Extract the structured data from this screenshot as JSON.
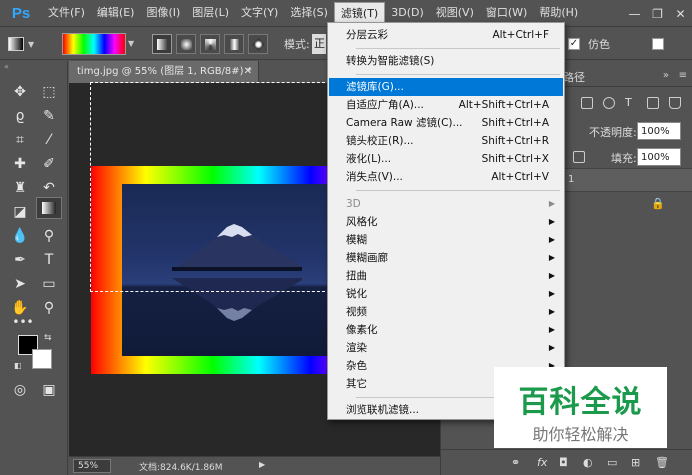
{
  "app": {
    "logo": "Ps"
  },
  "menubar": {
    "items": [
      "文件(F)",
      "编辑(E)",
      "图像(I)",
      "图层(L)",
      "文字(Y)",
      "选择(S)",
      "滤镜(T)",
      "3D(D)",
      "视图(V)",
      "窗口(W)",
      "帮助(H)"
    ],
    "active": "滤镜(T)"
  },
  "window_controls": {
    "minimize": "—",
    "maximize": "❐",
    "close": "✕"
  },
  "options": {
    "mode_label": "模式:",
    "mode_value": "正",
    "dither_label": "仿色",
    "dither_checked": true
  },
  "document": {
    "tab_title": "timg.jpg @ 55% (图层 1, RGB/8#) *",
    "zoom": "55%",
    "doc_info": "文档:824.6K/1.86M"
  },
  "panels": {
    "paths_tab": "路径",
    "opacity_label": "不透明度:",
    "opacity_value": "100%",
    "fill_label": "填充:",
    "fill_value": "100%",
    "layer_1_label": "1"
  },
  "filter_menu": {
    "items": [
      {
        "label": "分层云彩",
        "shortcut": "Alt+Ctrl+F"
      },
      {
        "label": "转换为智能滤镜(S)",
        "shortcut": ""
      },
      {
        "label": "滤镜库(G)...",
        "shortcut": "",
        "highlighted": true
      },
      {
        "label": "自适应广角(A)...",
        "shortcut": "Alt+Shift+Ctrl+A"
      },
      {
        "label": "Camera Raw 滤镜(C)...",
        "shortcut": "Shift+Ctrl+A"
      },
      {
        "label": "镜头校正(R)...",
        "shortcut": "Shift+Ctrl+R"
      },
      {
        "label": "液化(L)...",
        "shortcut": "Shift+Ctrl+X"
      },
      {
        "label": "消失点(V)...",
        "shortcut": "Alt+Ctrl+V"
      },
      {
        "label": "3D",
        "submenu": true,
        "disabled": true
      },
      {
        "label": "风格化",
        "submenu": true
      },
      {
        "label": "模糊",
        "submenu": true
      },
      {
        "label": "模糊画廊",
        "submenu": true
      },
      {
        "label": "扭曲",
        "submenu": true
      },
      {
        "label": "锐化",
        "submenu": true
      },
      {
        "label": "视频",
        "submenu": true
      },
      {
        "label": "像素化",
        "submenu": true
      },
      {
        "label": "渲染",
        "submenu": true
      },
      {
        "label": "杂色",
        "submenu": true
      },
      {
        "label": "其它",
        "submenu": true
      },
      {
        "label": "浏览联机滤镜...",
        "shortcut": ""
      }
    ]
  },
  "watermark": {
    "title": "百科全说",
    "subtitle": "助你轻松解决"
  }
}
